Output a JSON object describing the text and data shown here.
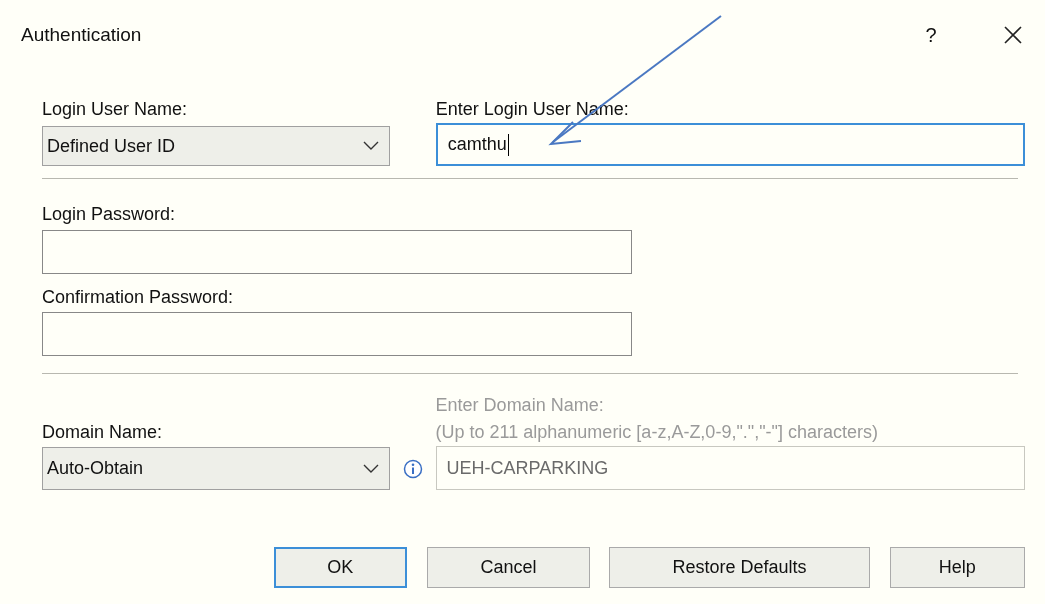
{
  "window": {
    "title": "Authentication",
    "help": "?"
  },
  "login_user_name": {
    "label": "Login User Name:",
    "value": "Defined User ID"
  },
  "enter_login_user_name": {
    "label": "Enter Login User Name:",
    "value": "camthu",
    "focused": true
  },
  "login_password": {
    "label": "Login Password:"
  },
  "confirmation_password": {
    "label": "Confirmation Password:"
  },
  "domain_name": {
    "label": "Domain Name:",
    "value": "Auto-Obtain"
  },
  "enter_domain_name": {
    "label": "Enter Domain Name:",
    "hint": "(Up to 211 alphanumeric [a-z,A-Z,0-9,\".\",\"-\"] characters)",
    "value": "UEH-CARPARKING",
    "disabled": true
  },
  "buttons": [
    {
      "label": "OK",
      "default": true
    },
    {
      "label": "Cancel",
      "default": false
    },
    {
      "label": "Restore Defaults",
      "default": false
    },
    {
      "label": "Help",
      "default": false
    }
  ]
}
